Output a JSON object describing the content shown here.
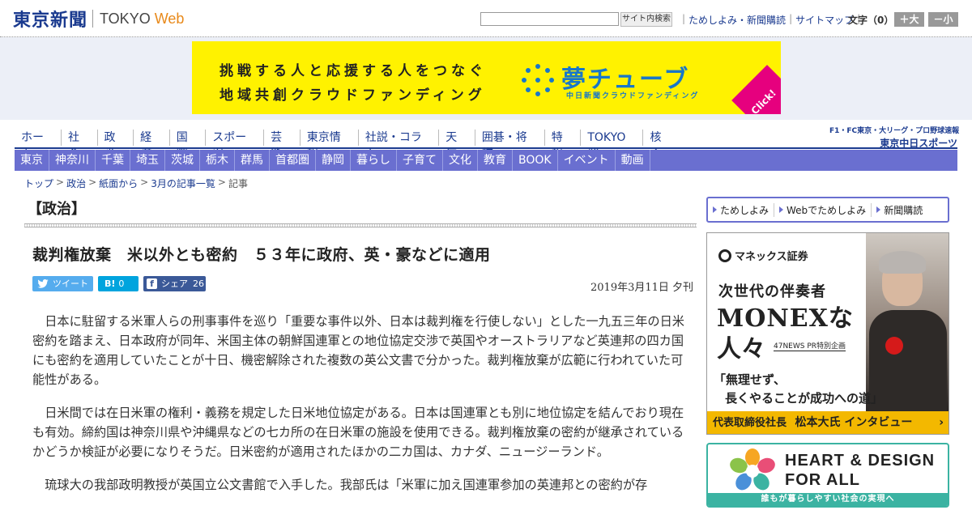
{
  "header": {
    "logo_jp": "東京新聞",
    "logo_en": "TOKYO",
    "logo_web": "Web",
    "search_button": "サイト内検索",
    "util_links": [
      "ためしよみ・新聞購読",
      "サイトマップ"
    ],
    "font_size_label": "文字（0）",
    "size_up": "＋大",
    "size_down": "－小"
  },
  "top_ad": {
    "line1": "挑戦する人と応援する人をつなぐ",
    "line2": "地域共創クラウドファンディング",
    "brand": "夢チューブ",
    "brand_sub": "中日新聞クラウドファンディング",
    "click": "Click!",
    "bg_color": "#fff200",
    "accent_color": "#1877c9"
  },
  "nav_main": [
    "ホーム",
    "社会",
    "政治",
    "経済",
    "国際",
    "スポーツ",
    "芸能",
    "東京情報",
    "社説・コラム",
    "天気",
    "囲碁・将棋",
    "特報",
    "TOKYO発",
    "核心"
  ],
  "chunichi": {
    "top": "F1・FC東京・大リーグ・プロ野球速報",
    "bottom": "東京中日スポーツ"
  },
  "nav_local": [
    "東京",
    "神奈川",
    "千葉",
    "埼玉",
    "茨城",
    "栃木",
    "群馬",
    "首都圏",
    "静岡",
    "暮らし",
    "子育て",
    "文化",
    "教育",
    "BOOK",
    "イベント",
    "動画"
  ],
  "breadcrumb": [
    "トップ",
    "政治",
    "紙面から",
    "3月の記事一覧",
    "記事"
  ],
  "section_heading": "【政治】",
  "article": {
    "title": "裁判権放棄　米以外とも密約　５３年に政府、英・豪などに適用",
    "date": "2019年3月11日 夕刊",
    "share": {
      "twitter": "ツイート",
      "hatena_count": "0",
      "facebook_label": "シェア",
      "facebook_count": "26"
    },
    "paragraphs": [
      "日本に駐留する米軍人らの刑事事件を巡り「重要な事件以外、日本は裁判権を行使しない」とした一九五三年の日米密約を踏まえ、日本政府が同年、米国主体の朝鮮国連軍との地位協定交渉で英国やオーストラリアなど英連邦の四カ国にも密約を適用していたことが十日、機密解除された複数の英公文書で分かった。裁判権放棄が広範に行われていた可能性がある。",
      "日米間では在日米軍の権利・義務を規定した日米地位協定がある。日本は国連軍とも別に地位協定を結んでおり現在も有効。締約国は神奈川県や沖縄県などの七カ所の在日米軍の施設を使用できる。裁判権放棄の密約が継承されているかどうか検証が必要になりそうだ。日米密約が適用されたほかの二カ国は、カナダ、ニュージーランド。",
      "琉球大の我部政明教授が英国立公文書館で入手した。我部氏は「米軍に加え国連軍参加の英連邦との密約が存"
    ]
  },
  "sidebar": {
    "sub_links": [
      "ためしよみ",
      "Webでためしよみ",
      "新聞購読"
    ],
    "monex": {
      "logo": "マネックス証券",
      "line1": "次世代の伴奏者",
      "line2": "MONEXな",
      "line3": "人々",
      "tag": "47NEWS PR特別企画",
      "quote1": "「無理せず、",
      "quote2": "長くやることが成功への道」",
      "footer_role": "代表取締役社長",
      "footer_name": "松本大氏 インタビュー",
      "footer_arrow": "›"
    },
    "heart": {
      "title1": "HEART & DESIGN",
      "title2": "FOR ALL",
      "footer": "誰もが暮らしやすい社会の実現へ"
    }
  },
  "colors": {
    "brand_blue": "#1a3a8f",
    "local_nav": "#6a6fd0",
    "heart_teal": "#3bb3a2",
    "monex_yellow": "#f3b800"
  }
}
